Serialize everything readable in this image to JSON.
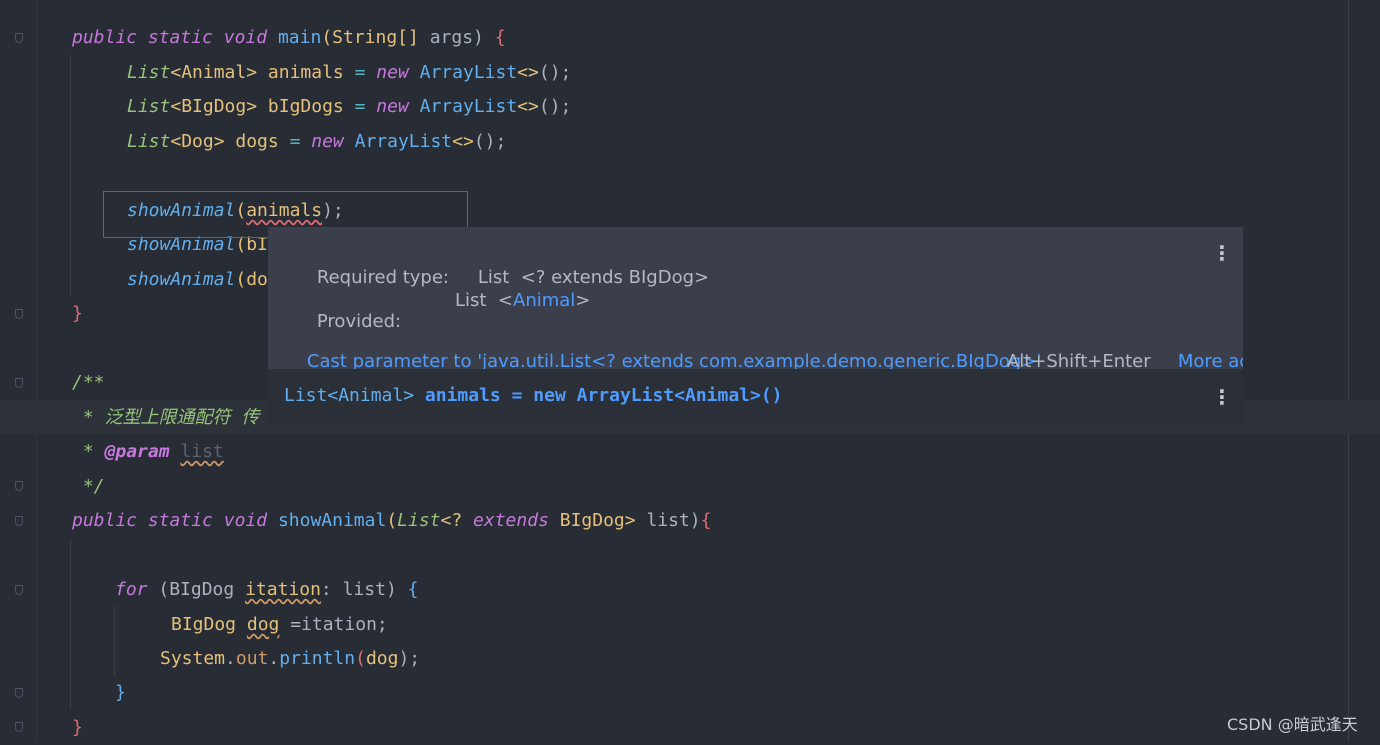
{
  "editor": {
    "lines": {
      "main_sig": {
        "kw1": "public",
        "kw2": "static",
        "kw3": "void",
        "fn": "main",
        "open": "(",
        "type": "String[]",
        "arg": " args) ",
        "brace": "{"
      },
      "l_animals": {
        "type": "List",
        "gen": "<Animal>",
        "name": " animals",
        "eq": " = ",
        "kw": "new",
        "cls": " ArrayList",
        "diam": "<>",
        "tail": "();"
      },
      "l_bigdogs": {
        "type": "List",
        "gen": "<BIgDog>",
        "name": " bIgDogs",
        "eq": " = ",
        "kw": "new",
        "cls": " ArrayList",
        "diam": "<>",
        "tail": "();"
      },
      "l_dogs": {
        "type": "List",
        "gen": "<Dog>",
        "name": " dogs",
        "eq": " = ",
        "kw": "new",
        "cls": " ArrayList",
        "diam": "<>",
        "tail": "();"
      },
      "call1": {
        "fn": "showAnimal",
        "open": "(",
        "arg": "animals",
        "close": ");"
      },
      "call2": {
        "fn": "showAnimal",
        "open": "(",
        "arg": "bI"
      },
      "call3": {
        "fn": "showAnimal",
        "open": "(",
        "arg": "do"
      },
      "close_main": "}",
      "doc_open": "/**",
      "doc_line": " * 泛型上限通配符 传",
      "doc_param_star": " * ",
      "doc_param_tag": "@param",
      "doc_param_name": "list",
      "doc_close": " */",
      "show_sig": {
        "kw1": "public",
        "kw2": "static",
        "kw3": "void",
        "fn": "showAnimal",
        "open": "(",
        "type": "List",
        "gen": "<? ",
        "ext": "extends",
        "cls": " BIgDog> ",
        "rest": "list)",
        "brace": "{"
      },
      "for_line": {
        "kw": "for",
        "open": " (BIgDog ",
        "var": "itation",
        "rest": ": list) ",
        "brace": "{"
      },
      "dog_line": {
        "type": "BIgDog ",
        "var": "dog",
        "rest": " =itation;"
      },
      "print_line": {
        "cls": "System",
        "dot": ".",
        "field": "out",
        "dot2": ".",
        "fn": "println",
        "open": "(",
        "arg": "dog",
        "close": ");"
      },
      "close_for": "}",
      "close_method": "}"
    }
  },
  "popup": {
    "required_label": "Required type:",
    "required_value": "List  <? extends BIgDog>",
    "provided_label": "Provided:",
    "provided_list": "List  <",
    "provided_type": "Animal",
    "provided_end": ">",
    "fix_action": "Cast parameter to 'java.util.List<? extends com.example.demo.generic.BIgDog>'",
    "fix_shortcut": "Alt+Shift+Enter",
    "more_actions": "More actio",
    "decl_list": "List",
    "decl_gen": "<Animal>",
    "decl_rest": " animals = new ArrayList<Animal>()",
    "menu_glyph": "⋮"
  },
  "watermark": "CSDN @暗武逢天",
  "colors": {
    "background": "#282c34",
    "popup": "#3a3f4b",
    "link": "#4f9cff",
    "error_box": "#e0302f"
  }
}
